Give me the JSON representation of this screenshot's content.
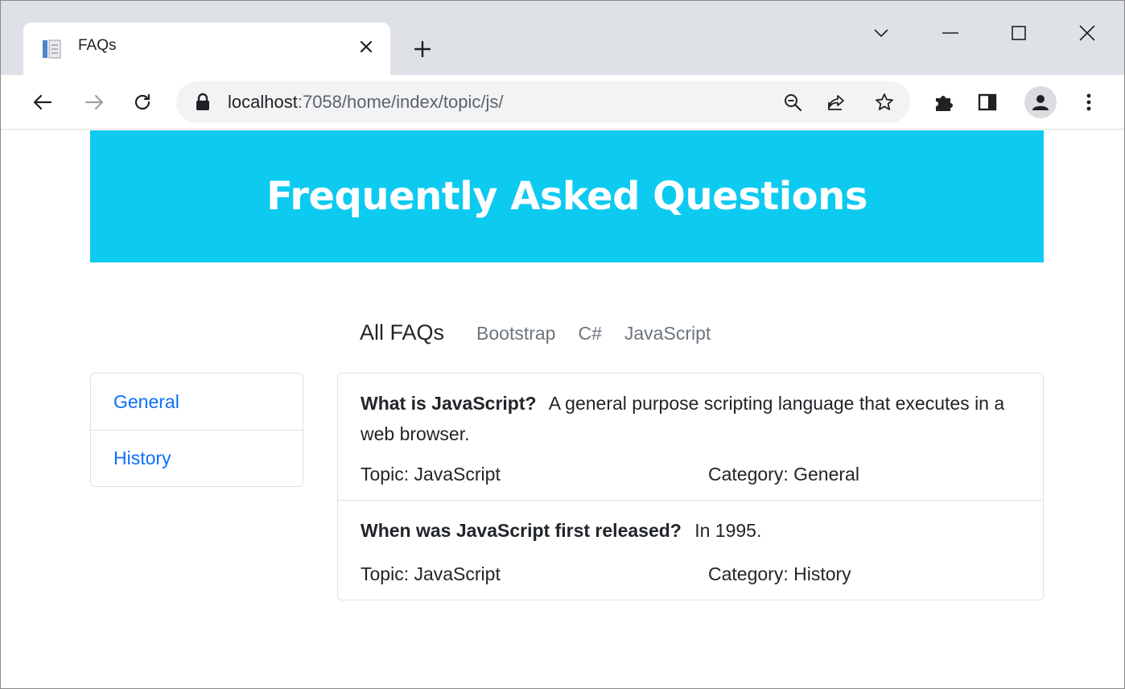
{
  "browser": {
    "tab_title": "FAQs",
    "url_host": "localhost",
    "url_path": ":7058/home/index/topic/js/"
  },
  "page": {
    "banner_title": "Frequently Asked Questions",
    "topic_nav": {
      "active": "All FAQs",
      "links": [
        "Bootstrap",
        "C#",
        "JavaScript"
      ]
    },
    "categories": [
      "General",
      "History"
    ],
    "faqs": [
      {
        "question": "What is JavaScript?",
        "answer": "A general purpose scripting language that executes in a web browser.",
        "topic": "Topic: JavaScript",
        "category": "Category: General"
      },
      {
        "question": "When was JavaScript first released?",
        "answer": "In 1995.",
        "topic": "Topic: JavaScript",
        "category": "Category: History"
      }
    ]
  },
  "colors": {
    "banner": "#0dcaf0",
    "link": "#0d6efd",
    "muted": "#6c757d"
  }
}
